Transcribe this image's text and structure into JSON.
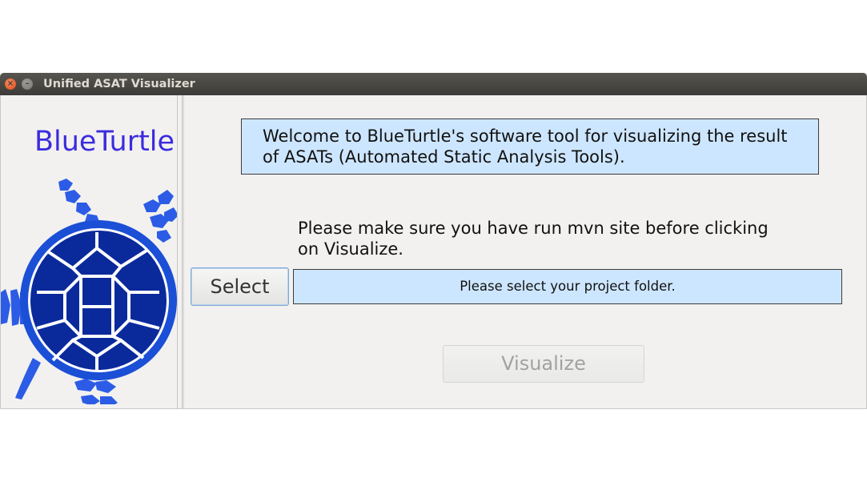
{
  "window": {
    "title": "Unified ASAT Visualizer",
    "close_glyph": "×",
    "minimize_glyph": "–"
  },
  "sidebar": {
    "brand": "BlueTurtle",
    "logo_icon": "turtle-logo",
    "brand_color": "#3b2cde"
  },
  "main": {
    "welcome": "Welcome to BlueTurtle's software tool for visualizing the result of ASATs (Automated Static Analysis Tools).",
    "hint": "Please make sure you have run mvn site before clicking on Visualize.",
    "select_label": "Select",
    "folder_status": "Please select your project folder.",
    "visualize_label": "Visualize",
    "visualize_enabled": false,
    "box_color": "#cde6ff"
  }
}
